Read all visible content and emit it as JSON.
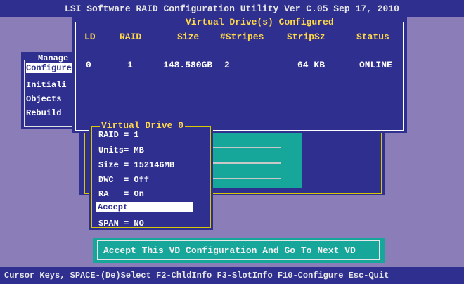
{
  "title": "LSI Software RAID Configuration Utility Ver C.05 Sep 17, 2010",
  "virtual_drives_configured": {
    "legend": "Virtual Drive(s) Configured",
    "headers": [
      "LD",
      "RAID",
      "Size",
      "#Stripes",
      "StripSz",
      "Status"
    ],
    "rows": [
      [
        "0",
        "1",
        "148.580GB",
        "2",
        "64 KB",
        "ONLINE"
      ]
    ]
  },
  "management_menu": {
    "legend": "Manage",
    "items": [
      "Configure",
      "Initiali",
      "Objects",
      "Rebuild"
    ]
  },
  "virtual_drive_0": {
    "legend": "Virtual Drive 0",
    "items": [
      "RAID = 1",
      "Units= MB",
      "Size = 152146MB",
      "DWC  = Off",
      "RA   = On",
      "Accept",
      "SPAN = NO"
    ]
  },
  "accept_button": {
    "label": "Accept This VD Configuration And Go To Next VD"
  },
  "status_bar": {
    "text": "Cursor Keys, SPACE-(De)Select F2-ChldInfo F3-SlotInfo F10-Configure Esc-Quit"
  },
  "colors": {
    "background": "#8a7db8",
    "panel": "#2f2f8f",
    "highlight": "#ffd84a",
    "accent": "#16a79a",
    "selection": "#ffffff"
  }
}
